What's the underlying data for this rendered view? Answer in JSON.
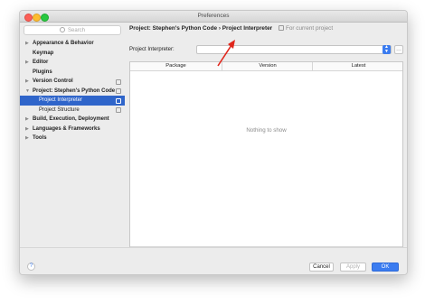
{
  "window": {
    "title": "Preferences"
  },
  "sidebar": {
    "search_placeholder": "Search",
    "items": [
      {
        "label": "Appearance & Behavior",
        "arrow": "▶",
        "level": 0
      },
      {
        "label": "Keymap",
        "arrow": "",
        "level": 0
      },
      {
        "label": "Editor",
        "arrow": "▶",
        "level": 0
      },
      {
        "label": "Plugins",
        "arrow": "",
        "level": 0
      },
      {
        "label": "Version Control",
        "arrow": "▶",
        "level": 0,
        "icon": "copy-icon"
      },
      {
        "label": "Project: Stephen's Python Code",
        "arrow": "▼",
        "level": 0,
        "icon": "copy-icon"
      },
      {
        "label": "Project Interpreter",
        "arrow": "",
        "level": 1,
        "selected": true,
        "icon": "copy-icon"
      },
      {
        "label": "Project Structure",
        "arrow": "",
        "level": 1,
        "icon": "copy-icon"
      },
      {
        "label": "Build, Execution, Deployment",
        "arrow": "▶",
        "level": 0
      },
      {
        "label": "Languages & Frameworks",
        "arrow": "▶",
        "level": 0
      },
      {
        "label": "Tools",
        "arrow": "▶",
        "level": 0
      }
    ]
  },
  "main": {
    "breadcrumb_project": "Project: Stephen's Python Code",
    "breadcrumb_sep": "›",
    "breadcrumb_page": "Project Interpreter",
    "breadcrumb_note": "For current project",
    "interpreter_label": "Project Interpreter:",
    "interpreter_value": "",
    "table": {
      "columns": [
        "Package",
        "Version",
        "Latest"
      ],
      "empty_text": "Nothing to show",
      "toolbar": [
        "+",
        "−",
        "▲"
      ]
    }
  },
  "buttons": {
    "help": "?",
    "cancel": "Cancel",
    "apply": "Apply",
    "ok": "OK"
  },
  "colors": {
    "accent": "#3b7cf0",
    "selection": "#2f65ca",
    "annotation_arrow": "#e0261b"
  }
}
